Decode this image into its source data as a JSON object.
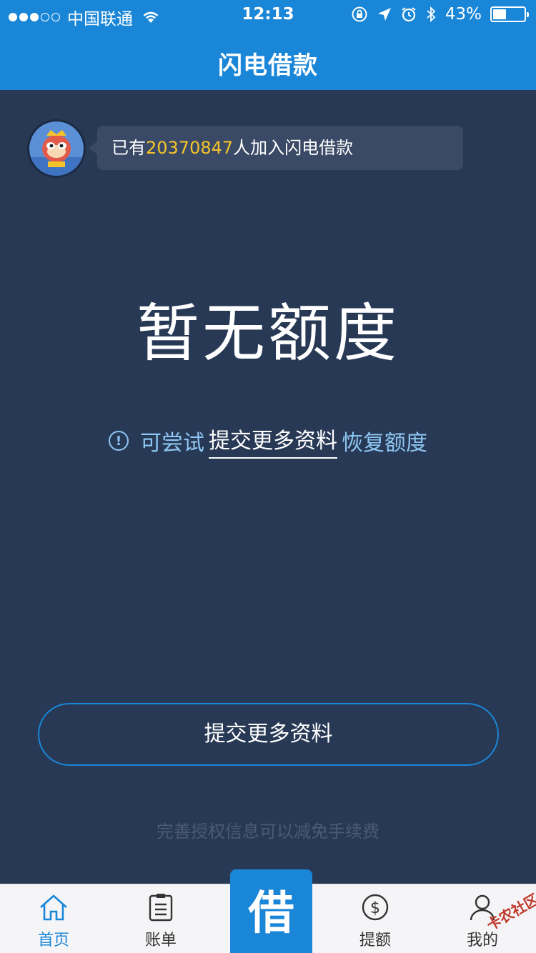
{
  "status_bar": {
    "carrier": "中国联通",
    "time": "12:13",
    "battery_percent_label": "43%",
    "battery_level": 0.43
  },
  "nav": {
    "title": "闪电借款"
  },
  "ticker": {
    "prefix": "已有",
    "count": "20370847",
    "suffix": "人加入闪电借款"
  },
  "quota": {
    "title": "暂无额度"
  },
  "hint": {
    "prefix": "可尝试",
    "link": "提交更多资料",
    "suffix": "恢复额度"
  },
  "submit_button": {
    "label": "提交更多资料"
  },
  "footer_note": "完善授权信息可以减免手续费",
  "tabs": [
    {
      "label": "首页",
      "icon": "home-icon",
      "active": true
    },
    {
      "label": "账单",
      "icon": "bill-icon",
      "active": false
    },
    {
      "label": "借",
      "icon": "borrow-icon",
      "active": false
    },
    {
      "label": "提额",
      "icon": "dollar-icon",
      "active": false
    },
    {
      "label": "我的",
      "icon": "user-icon",
      "active": false
    }
  ],
  "watermark": "卡农社区",
  "colors": {
    "primary": "#1a86d8",
    "background": "#283955",
    "highlight": "#f6c42a",
    "hint": "#8ec6f3"
  }
}
